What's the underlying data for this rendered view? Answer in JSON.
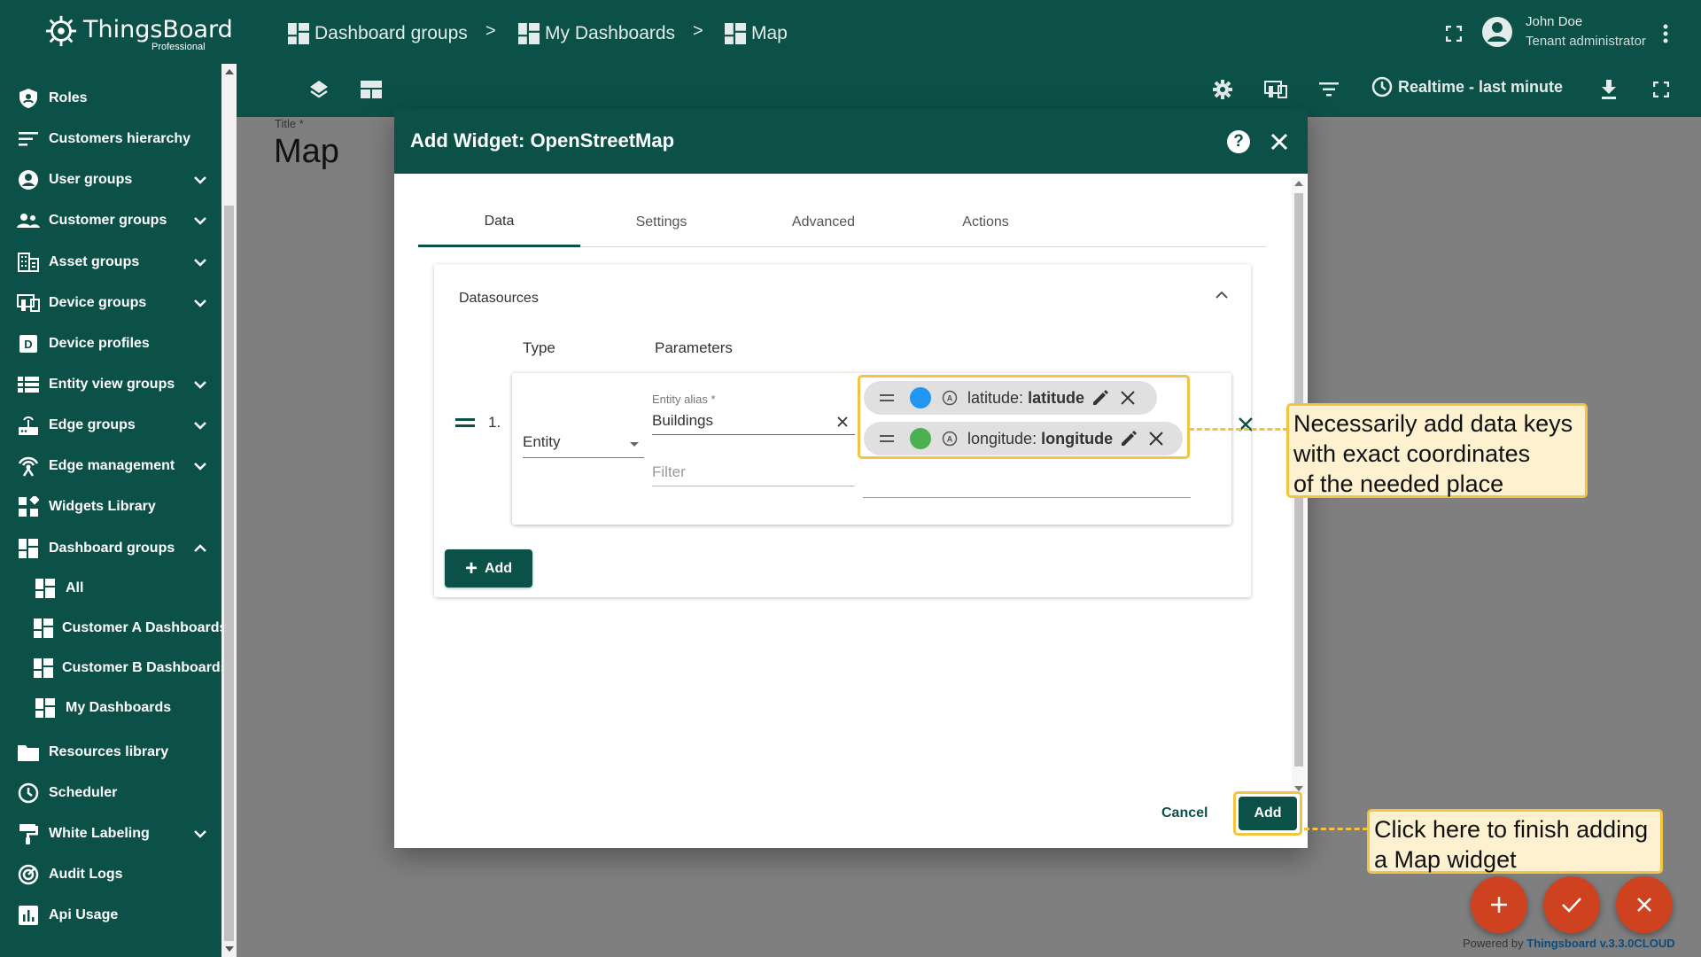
{
  "app": {
    "name": "ThingsBoard",
    "edition": "Professional"
  },
  "sidebar": {
    "items": [
      {
        "label": "Roles",
        "icon": "shield-icon",
        "expandable": false
      },
      {
        "label": "Customers hierarchy",
        "icon": "hierarchy-icon",
        "expandable": false
      },
      {
        "label": "User groups",
        "icon": "account-icon",
        "expandable": true
      },
      {
        "label": "Customer groups",
        "icon": "supervisor-icon",
        "expandable": true
      },
      {
        "label": "Asset groups",
        "icon": "domain-icon",
        "expandable": true
      },
      {
        "label": "Device groups",
        "icon": "devices-icon",
        "expandable": true
      },
      {
        "label": "Device profiles",
        "icon": "device-profile-icon",
        "expandable": false
      },
      {
        "label": "Entity view groups",
        "icon": "view-list-icon",
        "expandable": true
      },
      {
        "label": "Edge groups",
        "icon": "router-icon",
        "expandable": true
      },
      {
        "label": "Edge management",
        "icon": "edge-icon",
        "expandable": true
      },
      {
        "label": "Widgets Library",
        "icon": "widgets-icon",
        "expandable": false
      },
      {
        "label": "Dashboard groups",
        "icon": "dashboard-icon",
        "expandable": true,
        "expanded": true
      },
      {
        "label": "All",
        "icon": "dashboard-icon",
        "sub": true
      },
      {
        "label": "Customer A Dashboards",
        "icon": "dashboard-icon",
        "sub": true
      },
      {
        "label": "Customer B Dashboards",
        "icon": "dashboard-icon",
        "sub": true
      },
      {
        "label": "My Dashboards",
        "icon": "dashboard-icon",
        "sub": true
      },
      {
        "label": "Resources library",
        "icon": "folder-icon",
        "expandable": false
      },
      {
        "label": "Scheduler",
        "icon": "clock-icon",
        "expandable": false
      },
      {
        "label": "White Labeling",
        "icon": "format-paint-icon",
        "expandable": true
      },
      {
        "label": "Audit Logs",
        "icon": "track-changes-icon",
        "expandable": false
      },
      {
        "label": "Api Usage",
        "icon": "insert-chart-icon",
        "expandable": false
      }
    ]
  },
  "header": {
    "breadcrumbs": [
      "Dashboard groups",
      "My Dashboards",
      "Map"
    ],
    "separator": ">",
    "user_name": "John Doe",
    "user_role": "Tenant administrator",
    "timewindow": "Realtime - last minute"
  },
  "page": {
    "title_label": "Title *",
    "title_value": "Map"
  },
  "dialog": {
    "title": "Add Widget: OpenStreetMap",
    "help_label": "?",
    "tabs": [
      "Data",
      "Settings",
      "Advanced",
      "Actions"
    ],
    "active_tab": "Data",
    "datasources": {
      "title": "Datasources",
      "col_type": "Type",
      "col_params": "Parameters",
      "rows": [
        {
          "index": "1.",
          "type": "Entity",
          "alias_label": "Entity alias *",
          "alias_value": "Buildings",
          "filter_placeholder": "Filter",
          "keys": [
            {
              "label": "latitude:",
              "key": "latitude",
              "color": "#2196f3"
            },
            {
              "label": "longitude:",
              "key": "longitude",
              "color": "#4caf50"
            }
          ]
        }
      ],
      "add_label": "Add"
    },
    "cancel_label": "Cancel",
    "add_label": "Add"
  },
  "callouts": {
    "keys": "Necessarily add data keys with exact coordinates of the needed place",
    "keys_lines": [
      "Necessarily add data keys",
      "with exact coordinates",
      "of the needed place"
    ],
    "add_lines": [
      "Click here to finish adding",
      "a Map widget"
    ]
  },
  "footer": {
    "powered_prefix": "Powered by",
    "powered_link": "Thingsboard v.3.3.0CLOUD"
  },
  "colors": {
    "primary": "#0c5148",
    "accent": "#cf4220",
    "highlight": "#f5c342"
  }
}
